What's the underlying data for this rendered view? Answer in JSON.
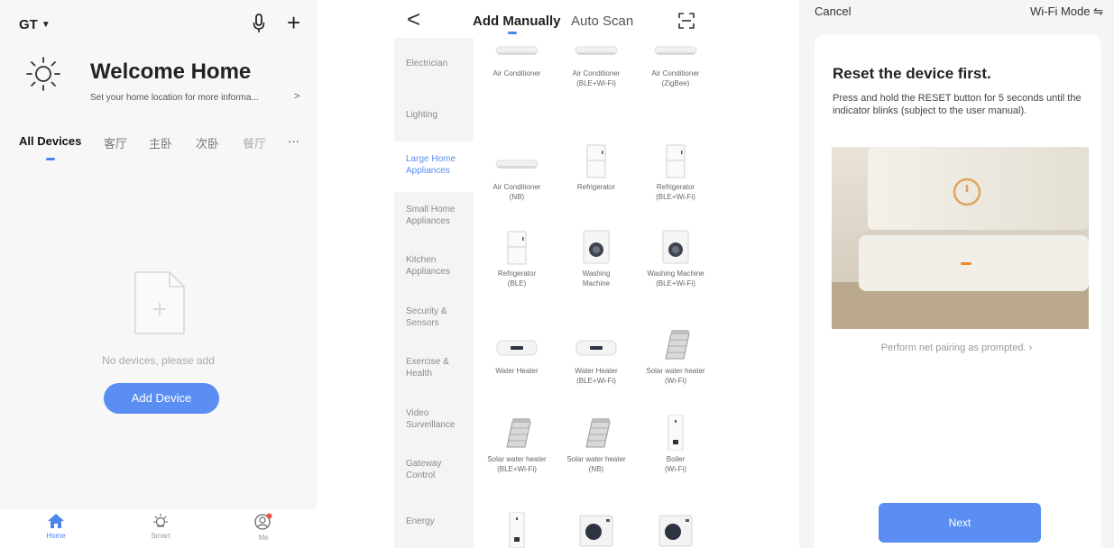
{
  "home": {
    "home_name": "GT",
    "welcome_title": "Welcome Home",
    "location_prompt": "Set your home location for more informa...",
    "location_chevron": ">",
    "rooms": [
      "All Devices",
      "客厅",
      "主卧",
      "次卧",
      "餐厅"
    ],
    "more": "···",
    "empty_text": "No devices, please add",
    "add_device_label": "Add Device",
    "nav": {
      "home": "Home",
      "smart": "Smart",
      "me": "Me"
    },
    "colors": {
      "accent": "#4a86ec",
      "button": "#5a8ef2",
      "badge": "#e8523f"
    }
  },
  "add_device": {
    "back": "<",
    "tab_manual": "Add Manually",
    "tab_auto": "Auto Scan",
    "categories": [
      "Electrician",
      "Lighting",
      "Large Home Appliances",
      "Small Home Appliances",
      "Kitchen Appliances",
      "Security & Sensors",
      "Exercise & Health",
      "Video Surveillance",
      "Gateway Control",
      "Energy"
    ],
    "selected_category": "Large Home Appliances",
    "devices": [
      {
        "name": "Air Conditioner",
        "sub": "",
        "icon": "air-conditioner"
      },
      {
        "name": "Air Conditioner",
        "sub": "(BLE+Wi-Fi)",
        "icon": "air-conditioner"
      },
      {
        "name": "Air Conditioner",
        "sub": "(ZigBee)",
        "icon": "air-conditioner"
      },
      {
        "name": "Air Conditioner",
        "sub": "(NB)",
        "icon": "air-conditioner"
      },
      {
        "name": "Refrigerator",
        "sub": "",
        "icon": "refrigerator"
      },
      {
        "name": "Refrigerator",
        "sub": "(BLE+Wi-Fi)",
        "icon": "refrigerator"
      },
      {
        "name": "Refrigerator",
        "sub": "(BLE)",
        "icon": "refrigerator"
      },
      {
        "name": "Washing",
        "sub": "Machine",
        "icon": "washing-machine"
      },
      {
        "name": "Washing Machine",
        "sub": "(BLE+Wi-Fi)",
        "icon": "washing-machine"
      },
      {
        "name": "Water Heater",
        "sub": "",
        "icon": "water-heater"
      },
      {
        "name": "Water Heater",
        "sub": "(BLE+Wi-Fi)",
        "icon": "water-heater"
      },
      {
        "name": "Solar water heater",
        "sub": "(Wi-Fi)",
        "icon": "solar-water-heater"
      },
      {
        "name": "Solar water heater",
        "sub": "(BLE+Wi-Fi)",
        "icon": "solar-water-heater"
      },
      {
        "name": "Solar water heater",
        "sub": "(NB)",
        "icon": "solar-water-heater"
      },
      {
        "name": "Boiler",
        "sub": "(Wi-Fi)",
        "icon": "boiler"
      },
      {
        "name": "",
        "sub": "",
        "icon": "boiler"
      },
      {
        "name": "",
        "sub": "",
        "icon": "heat-pump"
      },
      {
        "name": "",
        "sub": "",
        "icon": "heat-pump"
      }
    ]
  },
  "reset": {
    "cancel": "Cancel",
    "mode": "Wi-Fi Mode ⇋",
    "title": "Reset the device first.",
    "description": "Press and hold the RESET button for 5 seconds until the indicator blinks (subject to the user manual).",
    "hint": "Perform net pairing as prompted. ›",
    "next_label": "Next"
  }
}
